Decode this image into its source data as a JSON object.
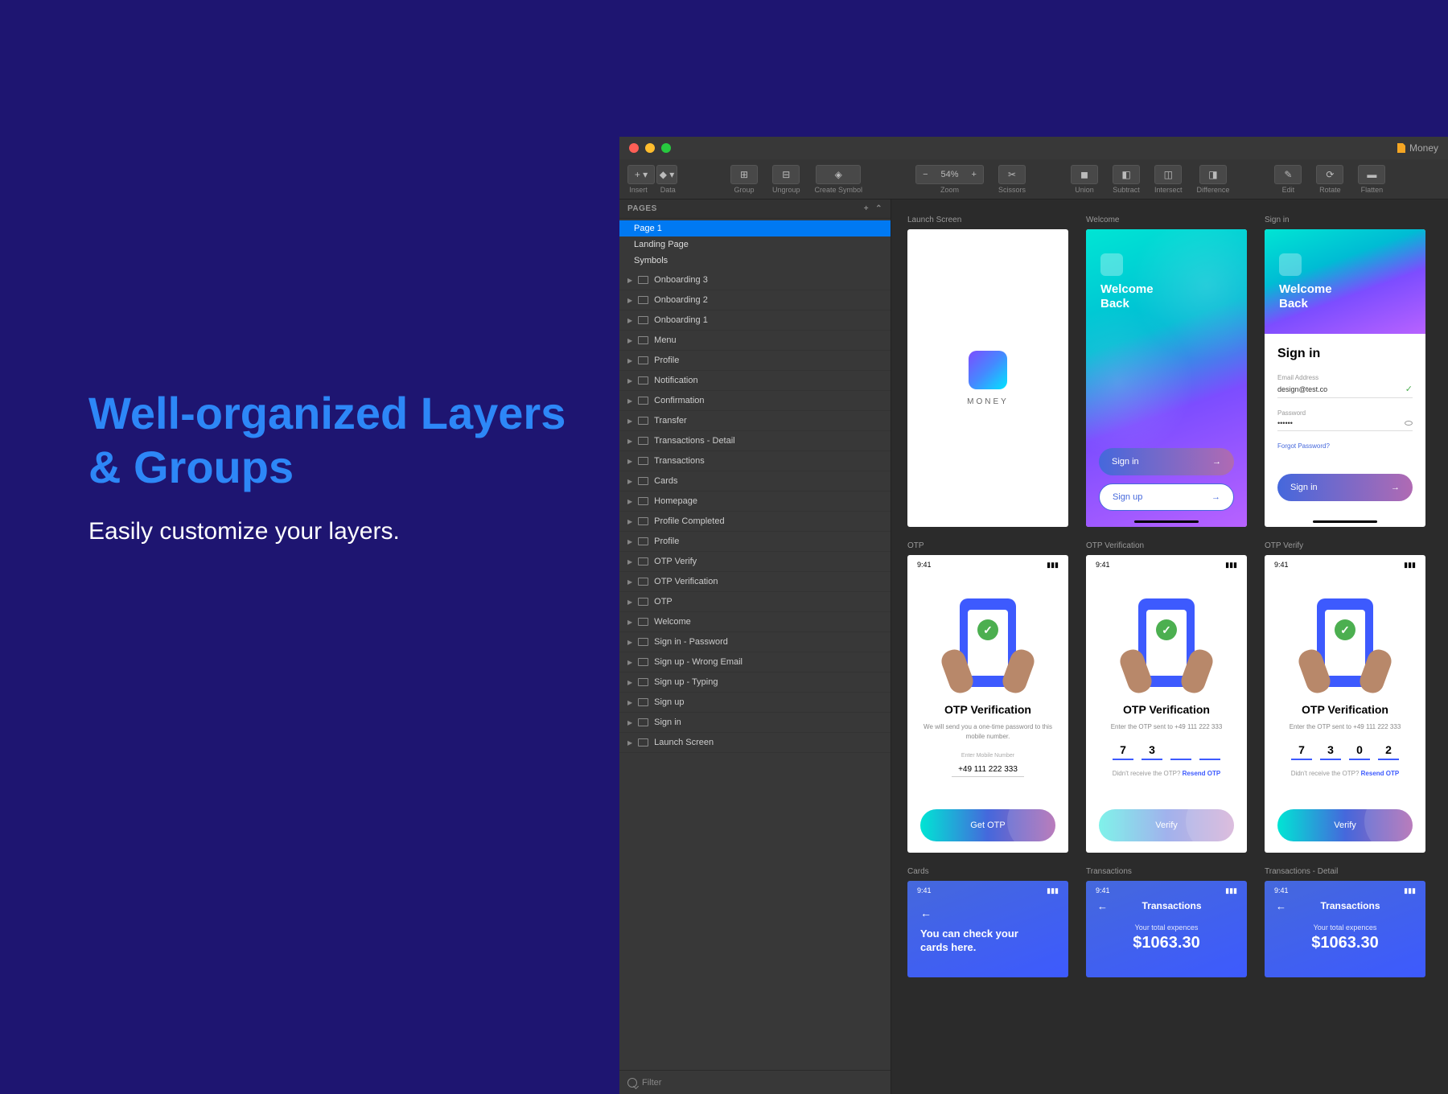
{
  "promo": {
    "headline": "Well-organized Layers & Groups",
    "sub": "Easily customize your layers."
  },
  "window": {
    "doc": "Money",
    "toolbar": {
      "insert": "Insert",
      "data": "Data",
      "group": "Group",
      "ungroup": "Ungroup",
      "create_symbol": "Create Symbol",
      "zoom": "Zoom",
      "zoom_level": "54%",
      "scissors": "Scissors",
      "union": "Union",
      "subtract": "Subtract",
      "intersect": "Intersect",
      "difference": "Difference",
      "edit": "Edit",
      "rotate": "Rotate",
      "flatten": "Flatten"
    },
    "sidebar": {
      "pages_label": "PAGES",
      "pages": [
        "Page 1",
        "Landing Page",
        "Symbols"
      ],
      "layers": [
        "Onboarding 3",
        "Onboarding 2",
        "Onboarding 1",
        "Menu",
        "Profile",
        "Notification",
        "Confirmation",
        "Transfer",
        "Transactions - Detail",
        "Transactions",
        "Cards",
        "Homepage",
        "Profile Completed",
        "Profile",
        "OTP Verify",
        "OTP Verification",
        "OTP",
        "Welcome",
        "Sign in - Password",
        "Sign up - Wrong Email",
        "Sign up - Typing",
        "Sign up",
        "Sign in",
        "Launch Screen"
      ],
      "filter": "Filter"
    }
  },
  "artboards": {
    "row1": [
      "Launch Screen",
      "Welcome",
      "Sign in"
    ],
    "row2": [
      "OTP",
      "OTP Verification",
      "OTP Verify"
    ],
    "row3": [
      "Cards",
      "Transactions",
      "Transactions - Detail"
    ]
  },
  "launch": {
    "brand": "MONEY"
  },
  "welcome": {
    "line1": "Welcome",
    "line2": "Back",
    "signin": "Sign in",
    "signup": "Sign up"
  },
  "signin": {
    "title": "Sign in",
    "email_label": "Email Address",
    "email_value": "design@test.co",
    "pw_label": "Password",
    "pw_value": "••••••",
    "forgot": "Forgot Password?",
    "btn": "Sign in"
  },
  "otp": {
    "time": "9:41",
    "title": "OTP Verification",
    "desc1": "We will send you a one-time password to this mobile number.",
    "mob_label": "Enter Mobile Number",
    "phone": "+49 111 222 333",
    "get_btn": "Get OTP",
    "desc2": "Enter the OTP sent to +49 111 222 333",
    "codes_partial": [
      "7",
      "3",
      "",
      ""
    ],
    "codes_full": [
      "7",
      "3",
      "0",
      "2"
    ],
    "resend_a": "Didn't receive the OTP? ",
    "resend_b": "Resend OTP",
    "verify": "Verify"
  },
  "cards": {
    "back": "←",
    "line1": "You can check your",
    "line2": "cards here."
  },
  "trans": {
    "title": "Transactions",
    "sub": "Your total expences",
    "amount": "$1063.30"
  }
}
